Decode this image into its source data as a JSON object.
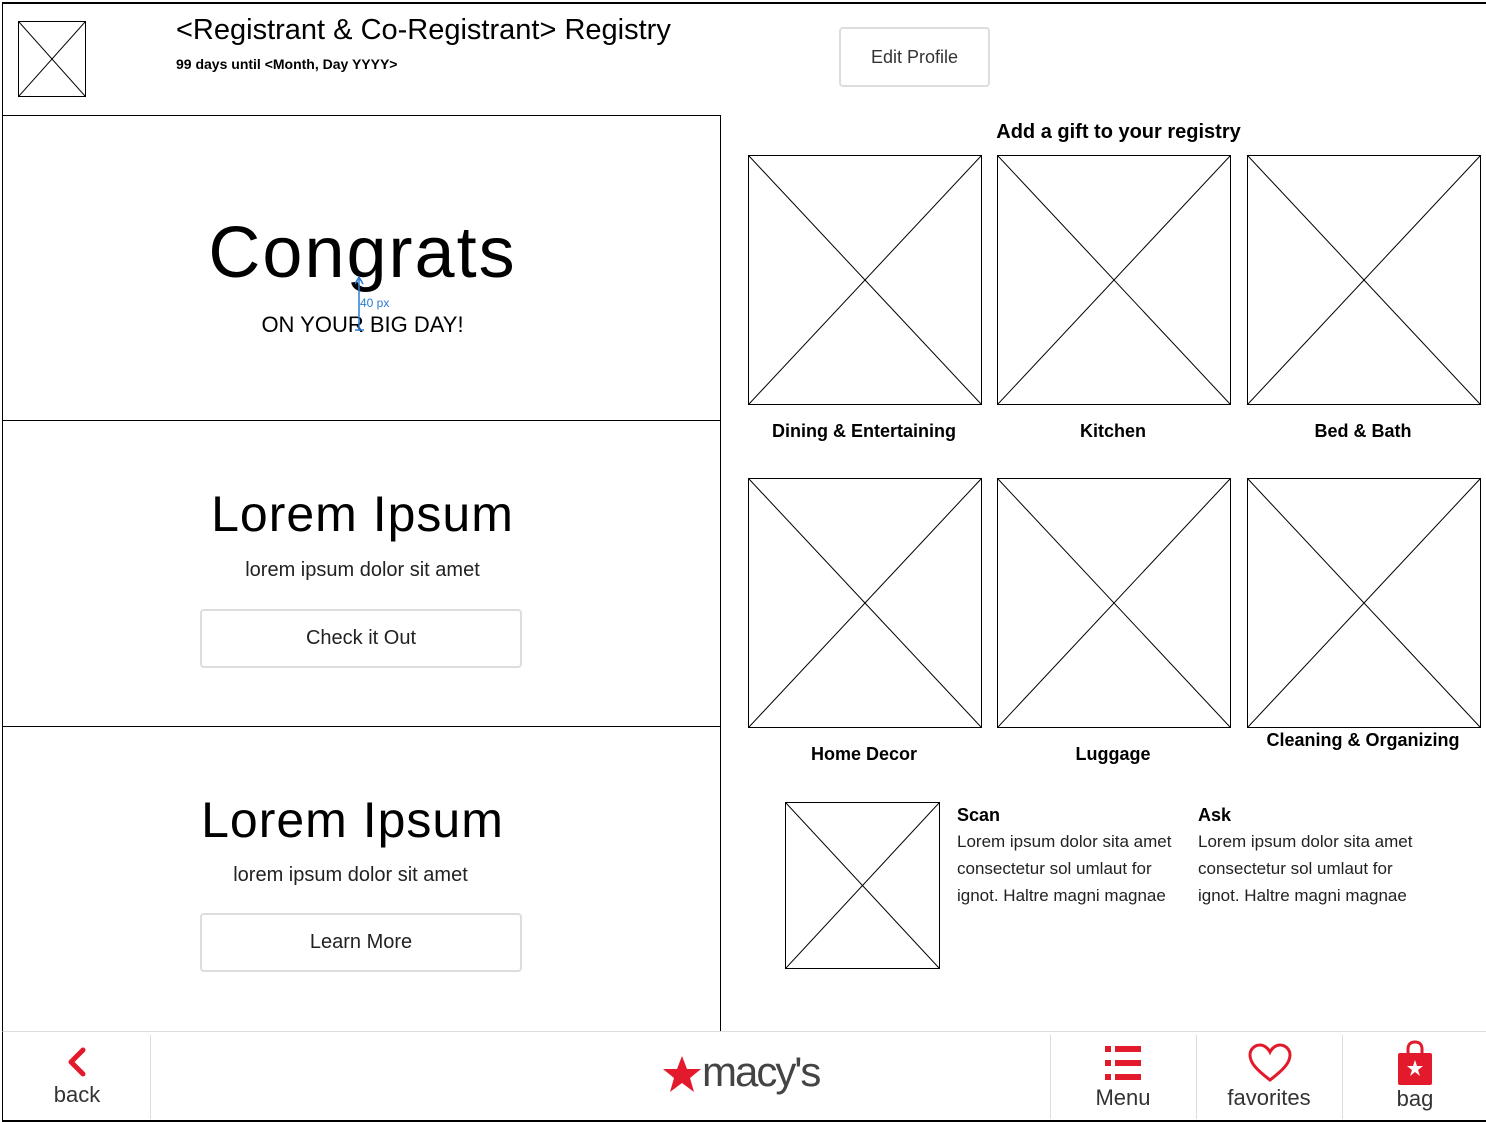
{
  "header": {
    "title": "<Registrant & Co-Registrant> Registry",
    "countdown": "99 days until <Month, Day  YYYY>",
    "edit_profile_label": "Edit Profile"
  },
  "congrats": {
    "title": "Congrats",
    "subtitle": "ON YOUR BIG DAY!",
    "spacing_annotation": "40 px"
  },
  "promos": [
    {
      "title": "Lorem Ipsum",
      "subtitle": "lorem ipsum dolor sit amet",
      "button_label": "Check it Out"
    },
    {
      "title": "Lorem Ipsum",
      "subtitle": "lorem ipsum dolor sit amet",
      "button_label": "Learn More"
    }
  ],
  "gifts": {
    "heading": "Add a gift to your registry",
    "categories": [
      {
        "label": "Dining & Entertaining"
      },
      {
        "label": "Kitchen"
      },
      {
        "label": "Bed & Bath"
      },
      {
        "label": "Home Decor"
      },
      {
        "label": "Luggage"
      },
      {
        "label": "Cleaning & Organizing"
      }
    ]
  },
  "info": {
    "scan": {
      "title": "Scan",
      "body": "Lorem ipsum dolor sita amet consectetur sol umlaut for ignot. Haltre magni magnae"
    },
    "ask": {
      "title": "Ask",
      "body": "Lorem ipsum dolor sita amet consectetur sol umlaut for ignot. Haltre magni magnae"
    }
  },
  "nav": {
    "back_label": "back",
    "brand": "macy's",
    "menu_label": "Menu",
    "favorites_label": "favorites",
    "bag_label": "bag"
  },
  "colors": {
    "brand_red": "#e21a2c",
    "annotation_blue": "#2a7bd4",
    "button_border": "#dddddd"
  },
  "icons": {
    "back": "chevron-left-icon",
    "brand": "star-icon",
    "menu": "list-icon",
    "favorites": "heart-icon",
    "bag": "shopping-bag-icon"
  }
}
